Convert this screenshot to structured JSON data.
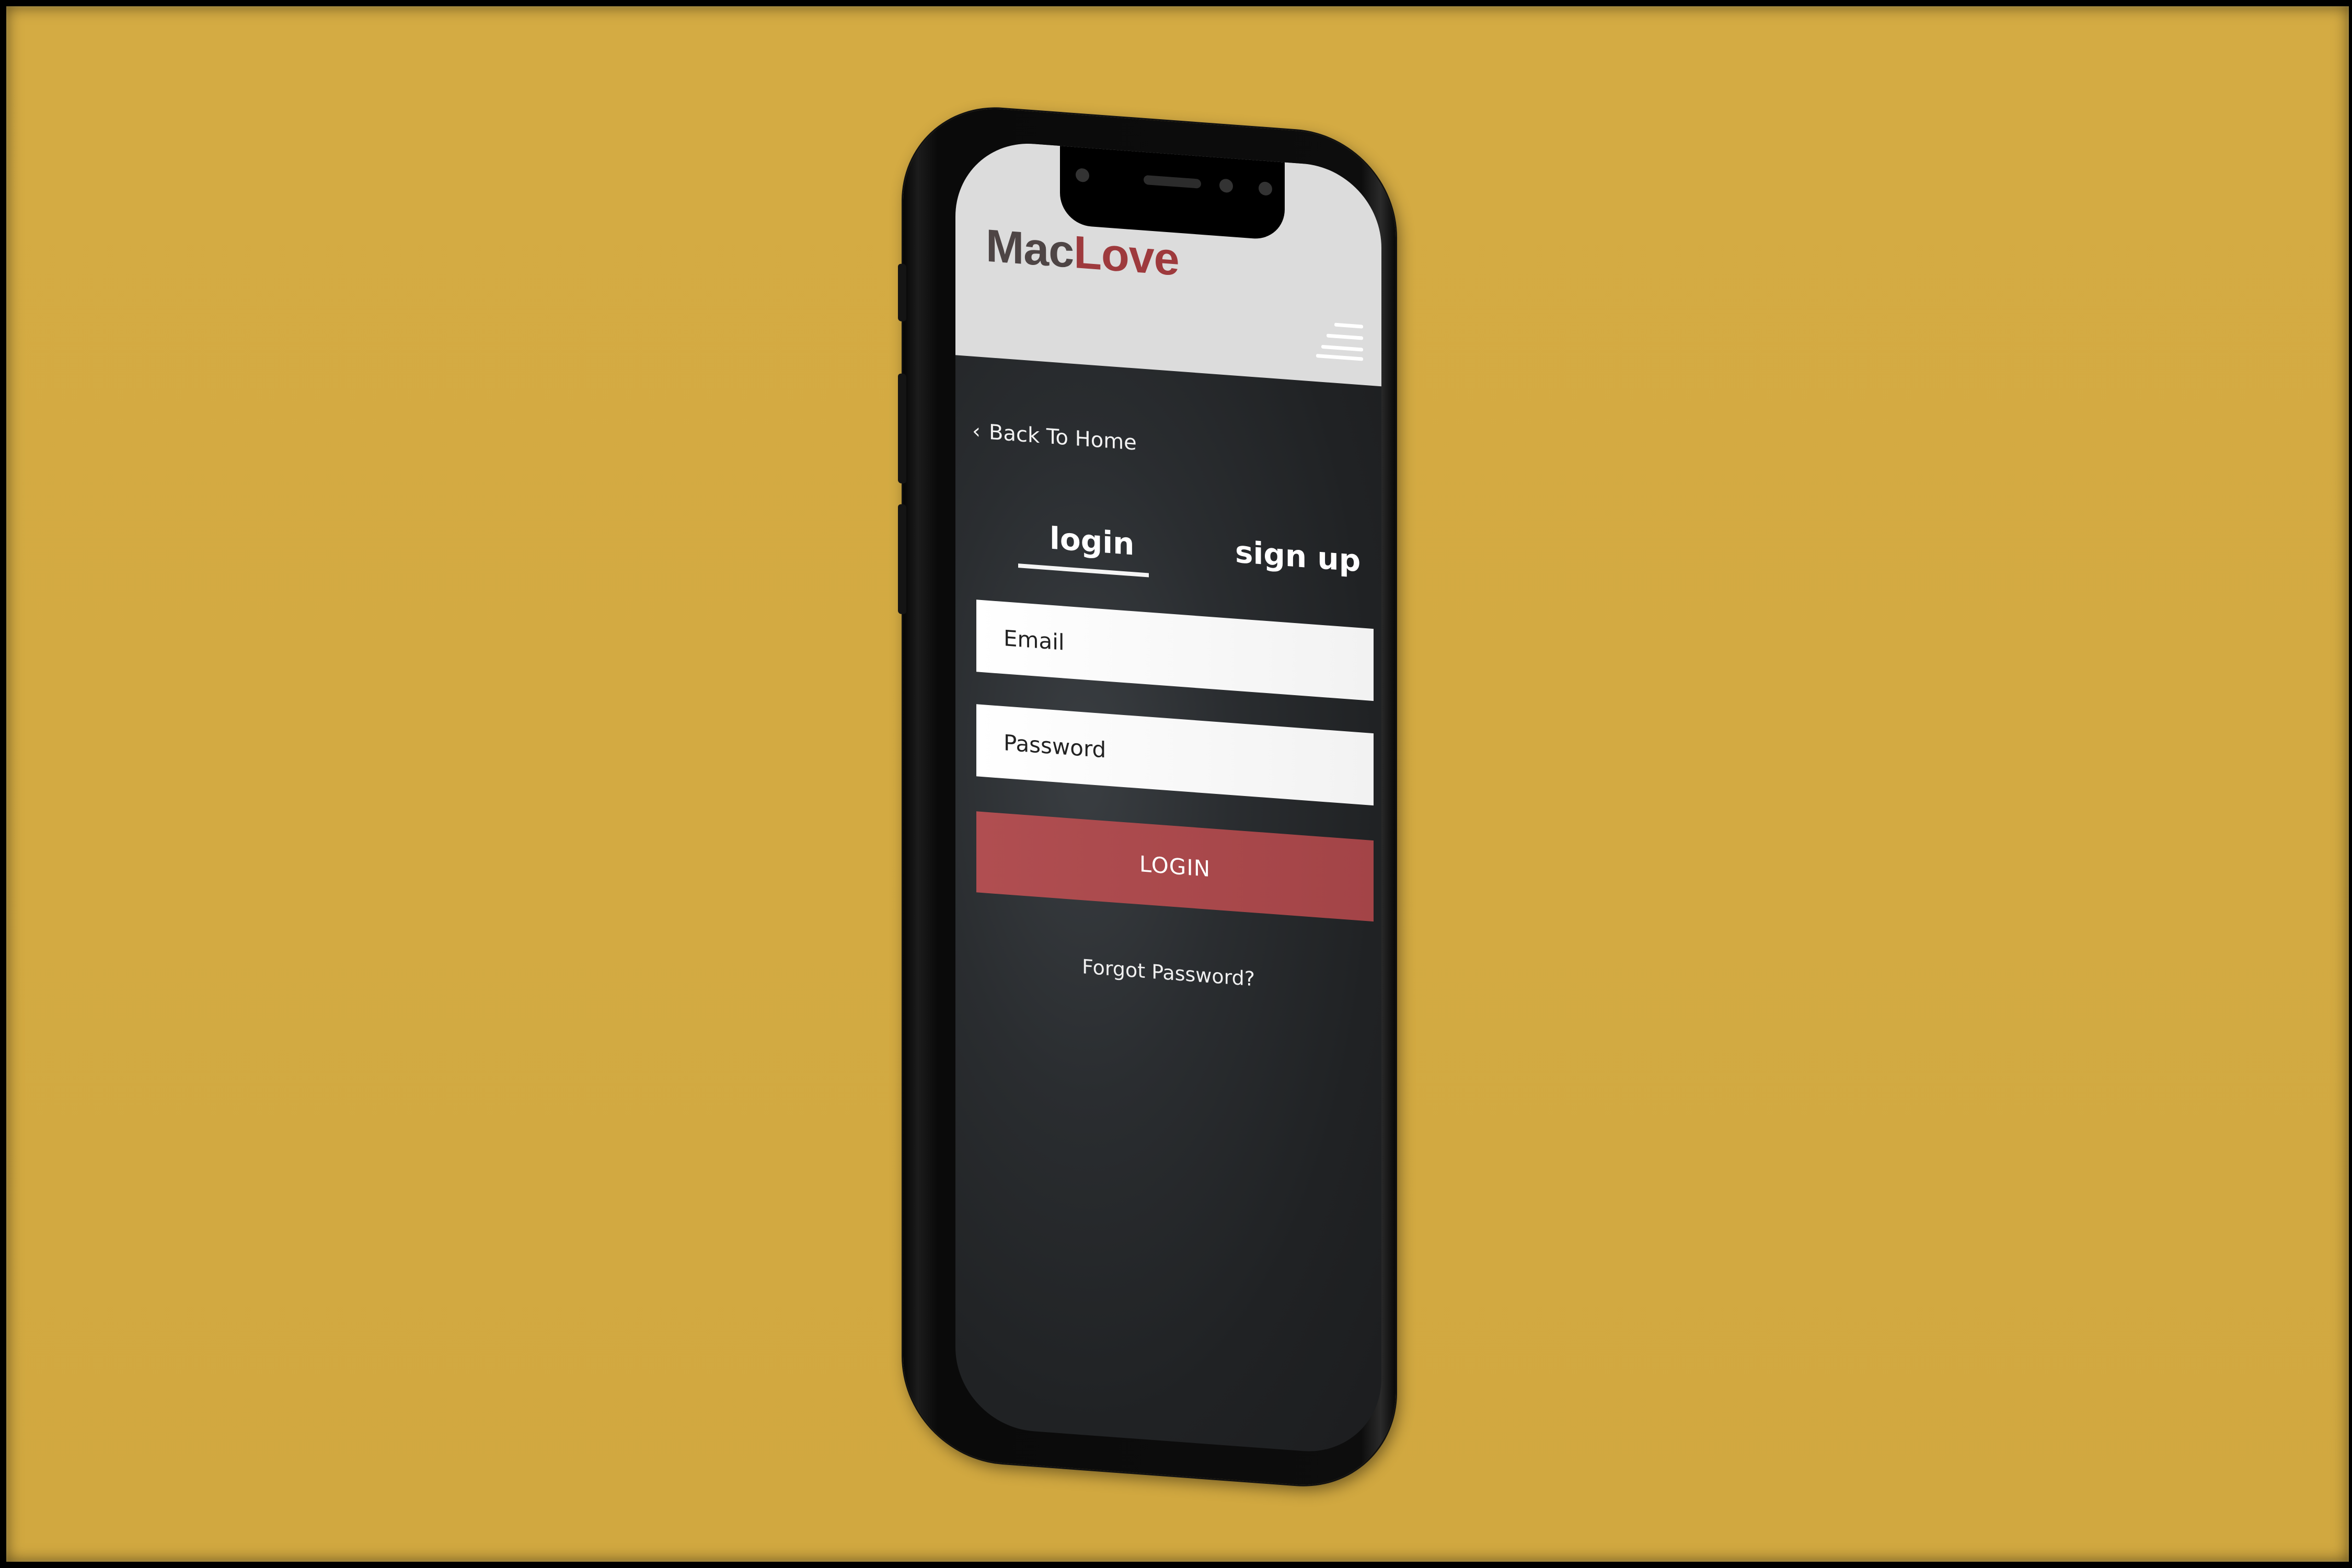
{
  "app": {
    "brand_part1": "Mac",
    "brand_part2": "Love"
  },
  "nav": {
    "back_label": "Back To Home",
    "back_icon": "chevron-left-icon",
    "menu_icon": "hamburger-menu-icon"
  },
  "tabs": [
    {
      "label": "login",
      "active": true
    },
    {
      "label": "sign up",
      "active": false
    }
  ],
  "form": {
    "email_placeholder": "Email",
    "password_placeholder": "Password",
    "login_label": "LOGIN",
    "forgot_label": "Forgot Password?"
  },
  "colors": {
    "background": "#d4ab43",
    "brand_dark": "#4e4545",
    "brand_accent": "#9e3a3d",
    "button": "#aa4a4d",
    "screen_bg": "#25282a"
  }
}
